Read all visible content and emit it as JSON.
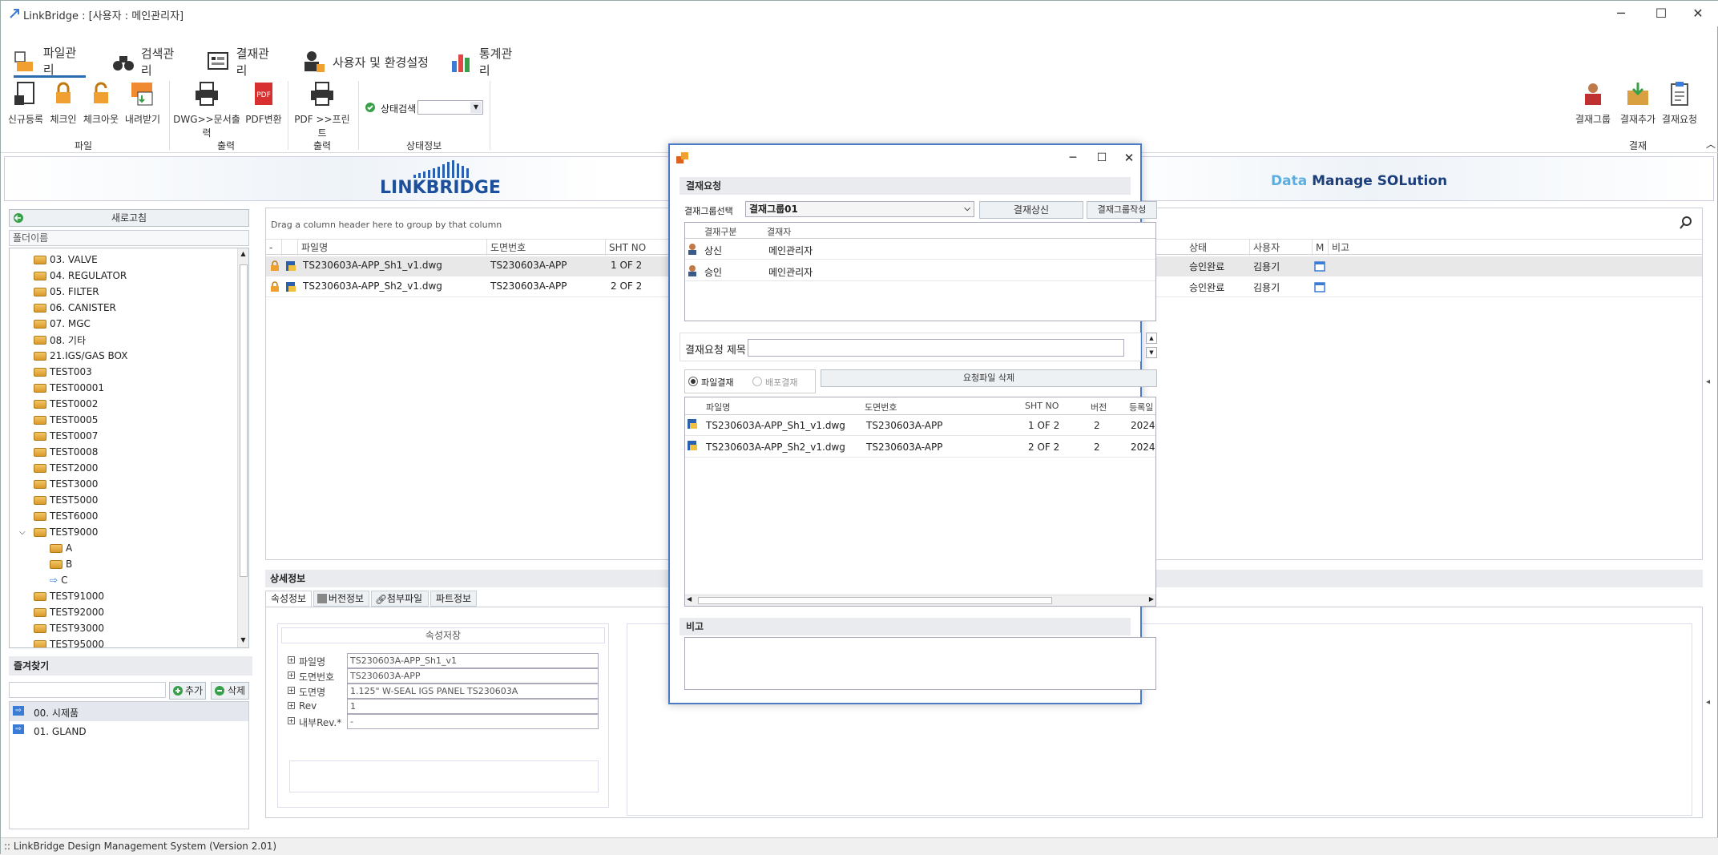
{
  "window": {
    "title": "LinkBridge : [사용자 : 메인관리자]"
  },
  "tabs": [
    {
      "label": "파일관리",
      "icon": "file-manage-icon"
    },
    {
      "label": "검색관리",
      "icon": "binoculars-icon"
    },
    {
      "label": "결재관리",
      "icon": "approval-icon"
    },
    {
      "label": "사용자 및 환경설정",
      "icon": "user-settings-icon"
    },
    {
      "label": "통계관리",
      "icon": "chart-icon"
    }
  ],
  "ribbon": {
    "buttons": [
      "신규등록",
      "체크인",
      "체크아웃",
      "내려받기",
      "DWG>>문서출력",
      "PDF변환",
      "PDF >>프린트",
      "결재그룹",
      "결재추가",
      "결재요청"
    ],
    "status_search": "상태검색",
    "groups": [
      "파일",
      "출력",
      "출력",
      "상태정보",
      "결재"
    ]
  },
  "banner": {
    "logo": "LINKBRIDGE",
    "tagline_accent": "Data",
    "tagline_rest": "Manage SOLution"
  },
  "left": {
    "refresh": "새로고침",
    "folder_header": "폴더이름",
    "folders": [
      "03. VALVE",
      "04. REGULATOR",
      "05. FILTER",
      "06. CANISTER",
      "07. MGC",
      "08. 기타",
      "21.IGS/GAS BOX",
      "TEST003",
      "TEST00001",
      "TEST0002",
      "TEST0005",
      "TEST0007",
      "TEST0008",
      "TEST2000",
      "TEST3000",
      "TEST5000",
      "TEST6000",
      "TEST9000",
      "A",
      "B",
      "C",
      "TEST91000",
      "TEST92000",
      "TEST93000",
      "TEST95000"
    ],
    "favorites_title": "즐겨찾기",
    "add": "추가",
    "delete": "삭제",
    "favorites": [
      "00. 시제품",
      "01. GLAND"
    ]
  },
  "grid": {
    "group_hint": "Drag a column header here to group by that column",
    "columns": [
      "파일명",
      "도면번호",
      "SHT NO",
      "상태",
      "사용자",
      "M",
      "비고"
    ],
    "rows": [
      {
        "file": "TS230603A-APP_Sh1_v1.dwg",
        "drawing": "TS230603A-APP",
        "sht": "1 OF 2",
        "status": "승인완료",
        "user": "김용기"
      },
      {
        "file": "TS230603A-APP_Sh2_v1.dwg",
        "drawing": "TS230603A-APP",
        "sht": "2 OF 2",
        "status": "승인완료",
        "user": "김용기"
      }
    ]
  },
  "detail": {
    "title": "상세정보",
    "tabs": [
      "속성정보",
      "버전정보",
      "첨부파일",
      "파트정보"
    ],
    "save": "속성저장",
    "fields": [
      {
        "label": "파일명",
        "value": "TS230603A-APP_Sh1_v1"
      },
      {
        "label": "도면번호",
        "value": "TS230603A-APP"
      },
      {
        "label": "도면명",
        "value": "1.125\" W-SEAL IGS PANEL TS230603A"
      },
      {
        "label": "Rev",
        "value": "1"
      },
      {
        "label": "내부Rev.*",
        "value": "-"
      }
    ]
  },
  "dialog": {
    "section": "결재요청",
    "group_label": "결재그룹선택",
    "group_value": "결재그룹01",
    "submit": "결재상신",
    "create_group": "결재그룹작성",
    "approver_cols": [
      "결재구분",
      "결재자"
    ],
    "approvers": [
      {
        "type": "상신",
        "name": "메인관리자"
      },
      {
        "type": "승인",
        "name": "메인관리자"
      }
    ],
    "title_label": "결재요청 제목",
    "radio_file": "파일결재",
    "radio_dist": "배포결재",
    "delete_files": "요청파일 삭제",
    "file_cols": [
      "파일명",
      "도면번호",
      "SHT NO",
      "버전",
      "등록일"
    ],
    "files": [
      {
        "file": "TS230603A-APP_Sh1_v1.dwg",
        "drawing": "TS230603A-APP",
        "sht": "1 OF 2",
        "ver": "2",
        "date": "2024-"
      },
      {
        "file": "TS230603A-APP_Sh2_v1.dwg",
        "drawing": "TS230603A-APP",
        "sht": "2 OF 2",
        "ver": "2",
        "date": "2024-"
      }
    ],
    "remark": "비고"
  },
  "statusbar": ":: LinkBridge Design Management System (Version 2.01)"
}
